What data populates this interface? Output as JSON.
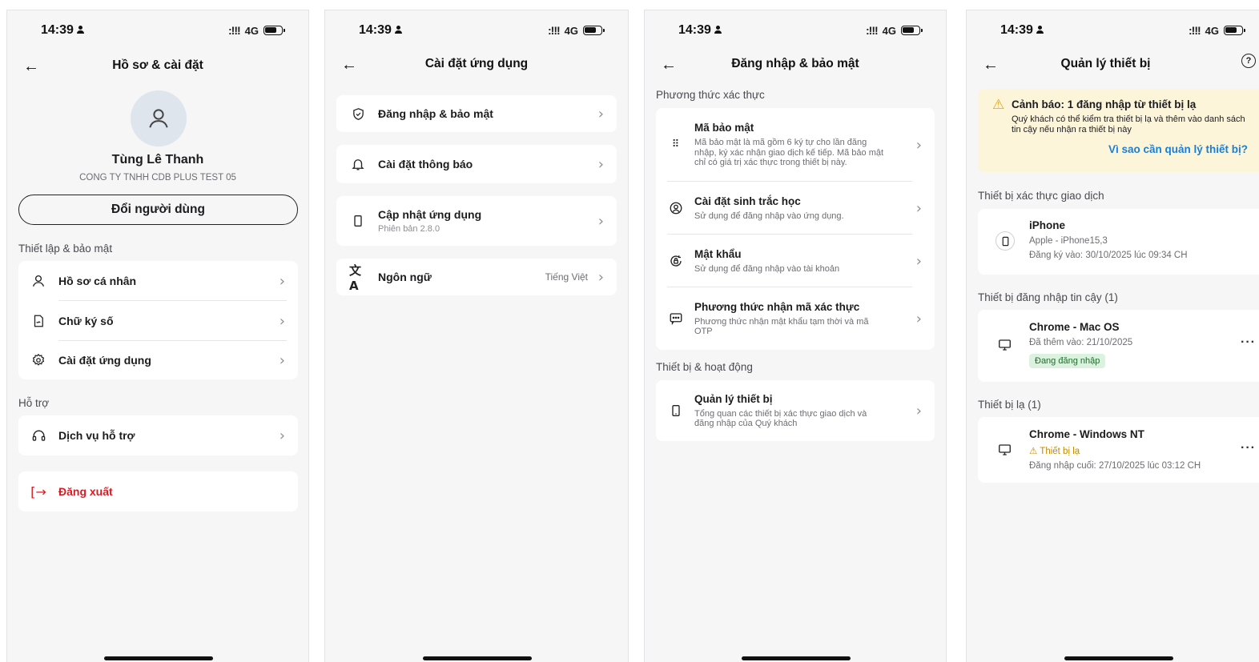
{
  "status": {
    "time": "14:39",
    "network": "4G",
    "signal": ":!!!"
  },
  "screen1": {
    "title": "Hồ sơ & cài đặt",
    "user_name": "Tùng Lê Thanh",
    "company": "CONG TY TNHH CDB PLUS TEST 05",
    "switch_user": "Đổi người dùng",
    "section_setup": "Thiết lập & bảo mật",
    "items": [
      {
        "label": "Hồ sơ cá nhân",
        "icon": "person-icon"
      },
      {
        "label": "Chữ ký số",
        "icon": "signature-icon"
      },
      {
        "label": "Cài đặt ứng dụng",
        "icon": "gear-icon"
      }
    ],
    "section_support": "Hỗ trợ",
    "support_item": "Dịch vụ hỗ trợ",
    "logout": "Đăng xuất"
  },
  "screen2": {
    "title": "Cài đặt ứng dụng",
    "items": [
      {
        "label": "Đăng nhập & bảo mật",
        "icon": "shield-icon"
      },
      {
        "label": "Cài đặt thông báo",
        "icon": "bell-icon"
      },
      {
        "label": "Cập nhật ứng dụng",
        "sub": "Phiên bản 2.8.0",
        "icon": "phone-icon"
      },
      {
        "label": "Ngôn ngữ",
        "value": "Tiếng Việt",
        "icon": "translate-icon"
      }
    ]
  },
  "screen3": {
    "title": "Đăng nhập & bảo mật",
    "section_auth": "Phương thức xác thực",
    "items": [
      {
        "label": "Mã bảo mật",
        "desc": "Mã bảo mật là mã gồm 6 ký tự cho lần đăng nhập, ký xác nhận giao dịch kế tiếp. Mã bảo mật chỉ có giá trị xác thực trong thiết bị này."
      },
      {
        "label": "Cài đặt sinh trắc học",
        "desc": "Sử dụng để đăng nhập vào ứng dụng."
      },
      {
        "label": "Mật khẩu",
        "desc": "Sử dụng để đăng nhập vào tài khoản"
      },
      {
        "label": "Phương thức nhận mã xác thực",
        "desc": "Phương thức nhận mật khẩu tạm thời và mã OTP"
      }
    ],
    "section_devices": "Thiết bị & hoạt động",
    "device_item": {
      "label": "Quản lý thiết bị",
      "desc": "Tổng quan các thiết bị xác thực giao dịch và đăng nhập của Quý khách"
    }
  },
  "screen4": {
    "title": "Quản lý thiết bị",
    "warning_title": "Cảnh báo: 1 đăng nhập từ thiết bị lạ",
    "warning_body": "Quý khách có thể kiểm tra thiết bị lạ và thêm vào danh sách tin cậy nếu nhận ra thiết bị này",
    "warning_link": "Vì sao cần quản lý thiết bị?",
    "section_tx": "Thiết bị xác thực giao dịch",
    "tx_device": {
      "name": "iPhone",
      "model": "Apple - iPhone15,3",
      "registered": "Đăng ký vào: 30/10/2025 lúc 09:34 CH"
    },
    "section_trusted": "Thiết bị đăng nhập tin cậy (1)",
    "trusted_device": {
      "name": "Chrome - Mac OS",
      "added": "Đã thêm vào: 21/10/2025",
      "badge": "Đang đăng nhập"
    },
    "section_strange": "Thiết bị lạ (1)",
    "strange_device": {
      "name": "Chrome - Windows NT",
      "flag": "Thiết bị lạ",
      "last_login": "Đăng nhập cuối: 27/10/2025 lúc 03:12 CH"
    }
  }
}
